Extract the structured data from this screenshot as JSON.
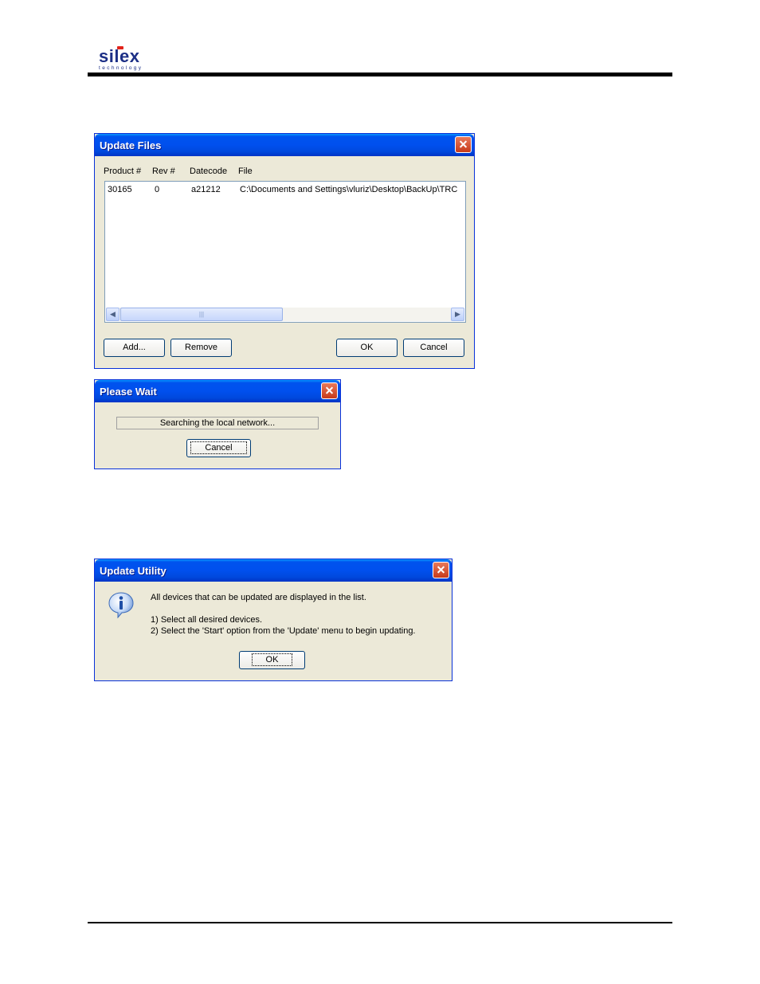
{
  "header": {
    "brand": "silex",
    "brand_sub": "technology"
  },
  "update_files": {
    "title": "Update Files",
    "columns": [
      "Product #",
      "Rev #",
      "Datecode",
      "File"
    ],
    "rows": [
      {
        "product": "30165",
        "rev": "0",
        "datecode": "a21212",
        "file": "C:\\Documents and Settings\\vluriz\\Desktop\\BackUp\\TRC"
      }
    ],
    "scroll_thumb_glyph": "|||",
    "add_label": "Add...",
    "remove_label": "Remove",
    "ok_label": "OK",
    "cancel_label": "Cancel"
  },
  "please_wait": {
    "title": "Please Wait",
    "status": "Searching the local network...",
    "cancel_label": "Cancel"
  },
  "update_utility": {
    "title": "Update Utility",
    "line1": "All devices that can be updated are displayed in the list.",
    "line2": "1) Select all desired devices.",
    "line3": "2) Select the 'Start' option from the 'Update' menu to begin updating.",
    "ok_label": "OK"
  }
}
